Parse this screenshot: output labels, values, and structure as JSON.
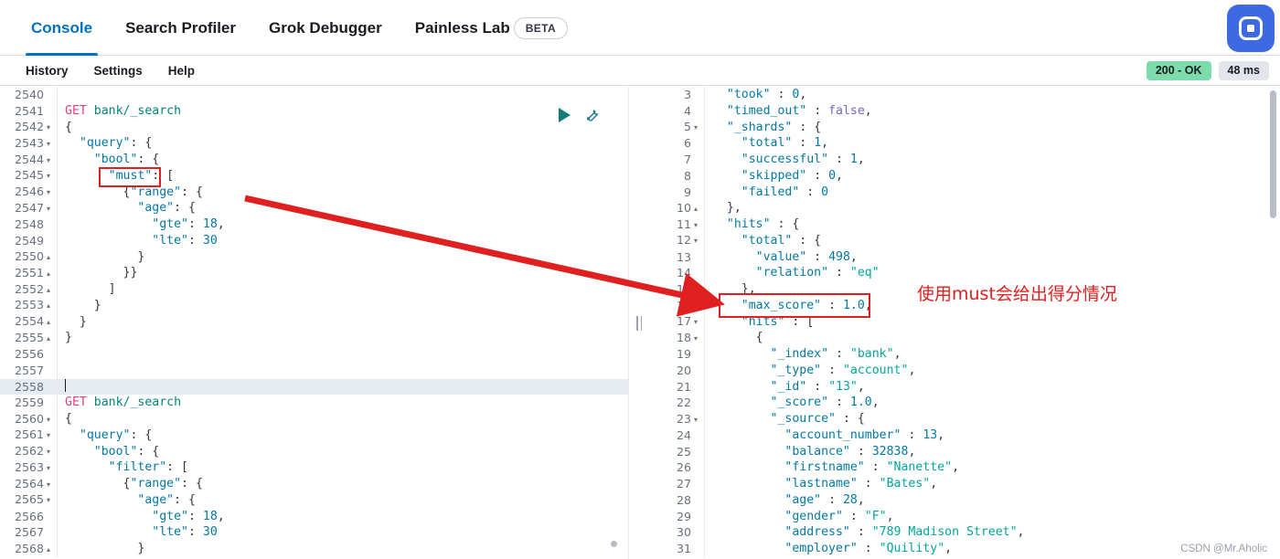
{
  "topbar": {
    "tabs": [
      {
        "label": "Console",
        "active": true
      },
      {
        "label": "Search Profiler",
        "active": false
      },
      {
        "label": "Grok Debugger",
        "active": false
      },
      {
        "label": "Painless Lab",
        "active": false
      }
    ],
    "beta_badge": "BETA",
    "app_button_icon": "app-square-icon"
  },
  "menubar": {
    "items": [
      "History",
      "Settings",
      "Help"
    ],
    "status_code": "200 - OK",
    "duration": "48 ms"
  },
  "editor_actions": {
    "run_icon": "play-icon",
    "settings_icon": "wrench-icon"
  },
  "request_editor": {
    "lines": [
      {
        "n": "2540",
        "fold": "",
        "html": ""
      },
      {
        "n": "2541",
        "fold": "",
        "html": "<span class=\"met\">GET</span> <span class=\"url\">bank/_search</span>"
      },
      {
        "n": "2542",
        "fold": "down",
        "html": "<span class=\"pun\">{</span>"
      },
      {
        "n": "2543",
        "fold": "down",
        "html": "  <span class=\"k\">\"query\"</span><span class=\"pun\">: {</span>"
      },
      {
        "n": "2544",
        "fold": "down",
        "html": "    <span class=\"k\">\"bool\"</span><span class=\"pun\">: {</span>"
      },
      {
        "n": "2545",
        "fold": "down",
        "html": "      <span class=\"k\">\"must\"</span><span class=\"pun\">: [</span>"
      },
      {
        "n": "2546",
        "fold": "down",
        "html": "        <span class=\"pun\">{</span><span class=\"k\">\"range\"</span><span class=\"pun\">: {</span>"
      },
      {
        "n": "2547",
        "fold": "down",
        "html": "          <span class=\"k\">\"age\"</span><span class=\"pun\">: {</span>"
      },
      {
        "n": "2548",
        "fold": "",
        "html": "            <span class=\"k\">\"gte\"</span><span class=\"pun\">:</span> <span class=\"num\">18</span><span class=\"pun\">,</span>"
      },
      {
        "n": "2549",
        "fold": "",
        "html": "            <span class=\"k\">\"lte\"</span><span class=\"pun\">:</span> <span class=\"num\">30</span>"
      },
      {
        "n": "2550",
        "fold": "up",
        "html": "          <span class=\"pun\">}</span>"
      },
      {
        "n": "2551",
        "fold": "up",
        "html": "        <span class=\"pun\">}}</span>"
      },
      {
        "n": "2552",
        "fold": "up",
        "html": "      <span class=\"pun\">]</span>"
      },
      {
        "n": "2553",
        "fold": "up",
        "html": "    <span class=\"pun\">}</span>"
      },
      {
        "n": "2554",
        "fold": "up",
        "html": "  <span class=\"pun\">}</span>"
      },
      {
        "n": "2555",
        "fold": "up",
        "html": "<span class=\"pun\">}</span>"
      },
      {
        "n": "2556",
        "fold": "",
        "html": ""
      },
      {
        "n": "2557",
        "fold": "",
        "html": ""
      },
      {
        "n": "2558",
        "fold": "",
        "html": "<span class=\"caret\"></span>",
        "highlight": true
      },
      {
        "n": "2559",
        "fold": "",
        "html": "<span class=\"met\">GET</span> <span class=\"url\">bank/_search</span>"
      },
      {
        "n": "2560",
        "fold": "down",
        "html": "<span class=\"pun\">{</span>"
      },
      {
        "n": "2561",
        "fold": "down",
        "html": "  <span class=\"k\">\"query\"</span><span class=\"pun\">: {</span>"
      },
      {
        "n": "2562",
        "fold": "down",
        "html": "    <span class=\"k\">\"bool\"</span><span class=\"pun\">: {</span>"
      },
      {
        "n": "2563",
        "fold": "down",
        "html": "      <span class=\"k\">\"filter\"</span><span class=\"pun\">: [</span>"
      },
      {
        "n": "2564",
        "fold": "down",
        "html": "        <span class=\"pun\">{</span><span class=\"k\">\"range\"</span><span class=\"pun\">: {</span>"
      },
      {
        "n": "2565",
        "fold": "down",
        "html": "          <span class=\"k\">\"age\"</span><span class=\"pun\">: {</span>"
      },
      {
        "n": "2566",
        "fold": "",
        "html": "            <span class=\"k\">\"gte\"</span><span class=\"pun\">:</span> <span class=\"num\">18</span><span class=\"pun\">,</span>"
      },
      {
        "n": "2567",
        "fold": "",
        "html": "            <span class=\"k\">\"lte\"</span><span class=\"pun\">:</span> <span class=\"num\">30</span>"
      },
      {
        "n": "2568",
        "fold": "up",
        "html": "          <span class=\"pun\">}</span>"
      }
    ]
  },
  "response_editor": {
    "lines": [
      {
        "n": "3",
        "fold": "",
        "html": "  <span class=\"k\">\"took\"</span> <span class=\"pun\">:</span> <span class=\"num\">0</span><span class=\"pun\">,</span>"
      },
      {
        "n": "4",
        "fold": "",
        "html": "  <span class=\"k\">\"timed_out\"</span> <span class=\"pun\">:</span> <span class=\"bool\">false</span><span class=\"pun\">,</span>"
      },
      {
        "n": "5",
        "fold": "down",
        "html": "  <span class=\"k\">\"_shards\"</span> <span class=\"pun\">: {</span>"
      },
      {
        "n": "6",
        "fold": "",
        "html": "    <span class=\"k\">\"total\"</span> <span class=\"pun\">:</span> <span class=\"num\">1</span><span class=\"pun\">,</span>"
      },
      {
        "n": "7",
        "fold": "",
        "html": "    <span class=\"k\">\"successful\"</span> <span class=\"pun\">:</span> <span class=\"num\">1</span><span class=\"pun\">,</span>"
      },
      {
        "n": "8",
        "fold": "",
        "html": "    <span class=\"k\">\"skipped\"</span> <span class=\"pun\">:</span> <span class=\"num\">0</span><span class=\"pun\">,</span>"
      },
      {
        "n": "9",
        "fold": "",
        "html": "    <span class=\"k\">\"failed\"</span> <span class=\"pun\">:</span> <span class=\"num\">0</span>"
      },
      {
        "n": "10",
        "fold": "up",
        "html": "  <span class=\"pun\">},</span>"
      },
      {
        "n": "11",
        "fold": "down",
        "html": "  <span class=\"k\">\"hits\"</span> <span class=\"pun\">: {</span>"
      },
      {
        "n": "12",
        "fold": "down",
        "html": "    <span class=\"k\">\"total\"</span> <span class=\"pun\">: {</span>"
      },
      {
        "n": "13",
        "fold": "",
        "html": "      <span class=\"k\">\"value\"</span> <span class=\"pun\">:</span> <span class=\"num\">498</span><span class=\"pun\">,</span>"
      },
      {
        "n": "14",
        "fold": "",
        "html": "      <span class=\"k\">\"relation\"</span> <span class=\"pun\">:</span> <span class=\"str\">\"eq\"</span>"
      },
      {
        "n": "15",
        "fold": "up",
        "html": "    <span class=\"pun\">},</span>"
      },
      {
        "n": "16",
        "fold": "",
        "html": "    <span class=\"k\">\"max_score\"</span> <span class=\"pun\">:</span> <span class=\"num\">1.0</span><span class=\"pun\">,</span>"
      },
      {
        "n": "17",
        "fold": "down",
        "html": "    <span class=\"k\">\"hits\"</span> <span class=\"pun\">: [</span>"
      },
      {
        "n": "18",
        "fold": "down",
        "html": "      <span class=\"pun\">{</span>"
      },
      {
        "n": "19",
        "fold": "",
        "html": "        <span class=\"k\">\"_index\"</span> <span class=\"pun\">:</span> <span class=\"str\">\"bank\"</span><span class=\"pun\">,</span>"
      },
      {
        "n": "20",
        "fold": "",
        "html": "        <span class=\"k\">\"_type\"</span> <span class=\"pun\">:</span> <span class=\"str\">\"account\"</span><span class=\"pun\">,</span>"
      },
      {
        "n": "21",
        "fold": "",
        "html": "        <span class=\"k\">\"_id\"</span> <span class=\"pun\">:</span> <span class=\"str\">\"13\"</span><span class=\"pun\">,</span>"
      },
      {
        "n": "22",
        "fold": "",
        "html": "        <span class=\"k\">\"_score\"</span> <span class=\"pun\">:</span> <span class=\"num\">1.0</span><span class=\"pun\">,</span>"
      },
      {
        "n": "23",
        "fold": "down",
        "html": "        <span class=\"k\">\"_source\"</span> <span class=\"pun\">: {</span>"
      },
      {
        "n": "24",
        "fold": "",
        "html": "          <span class=\"k\">\"account_number\"</span> <span class=\"pun\">:</span> <span class=\"num\">13</span><span class=\"pun\">,</span>"
      },
      {
        "n": "25",
        "fold": "",
        "html": "          <span class=\"k\">\"balance\"</span> <span class=\"pun\">:</span> <span class=\"num\">32838</span><span class=\"pun\">,</span>"
      },
      {
        "n": "26",
        "fold": "",
        "html": "          <span class=\"k\">\"firstname\"</span> <span class=\"pun\">:</span> <span class=\"str\">\"Nanette\"</span><span class=\"pun\">,</span>"
      },
      {
        "n": "27",
        "fold": "",
        "html": "          <span class=\"k\">\"lastname\"</span> <span class=\"pun\">:</span> <span class=\"str\">\"Bates\"</span><span class=\"pun\">,</span>"
      },
      {
        "n": "28",
        "fold": "",
        "html": "          <span class=\"k\">\"age\"</span> <span class=\"pun\">:</span> <span class=\"num\">28</span><span class=\"pun\">,</span>"
      },
      {
        "n": "29",
        "fold": "",
        "html": "          <span class=\"k\">\"gender\"</span> <span class=\"pun\">:</span> <span class=\"str\">\"F\"</span><span class=\"pun\">,</span>"
      },
      {
        "n": "30",
        "fold": "",
        "html": "          <span class=\"k\">\"address\"</span> <span class=\"pun\">:</span> <span class=\"str\">\"789 Madison Street\"</span><span class=\"pun\">,</span>"
      },
      {
        "n": "31",
        "fold": "",
        "html": "          <span class=\"k\">\"employer\"</span> <span class=\"pun\">:</span> <span class=\"str\">\"Quility\"</span><span class=\"pun\">,</span>"
      }
    ]
  },
  "annotations": {
    "note_text": "使用must会给出得分情况",
    "accent_color": "#e02020",
    "highlight_must": "must",
    "highlight_max_score": "\"max_score\" : 1.0,"
  },
  "watermark": "CSDN @Mr.Aholic"
}
